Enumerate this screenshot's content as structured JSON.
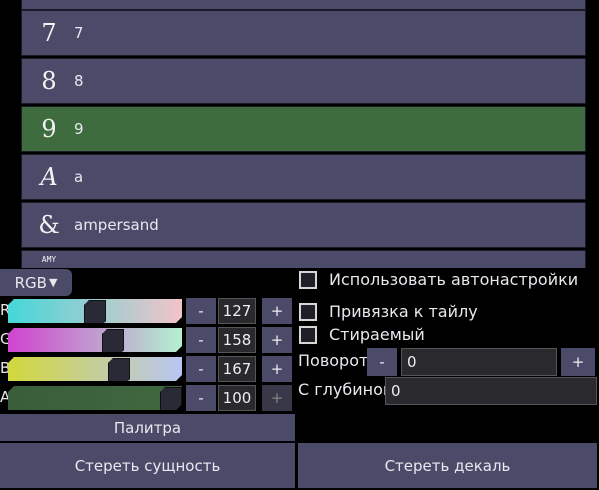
{
  "list": {
    "items": [
      {
        "glyph": "",
        "label": "",
        "selected": false
      },
      {
        "glyph": "7",
        "label": "7",
        "selected": false
      },
      {
        "glyph": "8",
        "label": "8",
        "selected": false
      },
      {
        "glyph": "9",
        "label": "9",
        "selected": true
      },
      {
        "glyph": "A",
        "label": "a",
        "selected": false
      },
      {
        "glyph": "&",
        "label": "ampersand",
        "selected": false
      },
      {
        "glyph": "AMY",
        "label": "",
        "selected": false
      }
    ]
  },
  "color_mode": {
    "label": "RGB",
    "arrow": "▼"
  },
  "channels": [
    {
      "label": "R",
      "value": "127",
      "fraction": 0.498,
      "gradient": [
        "#45d7d8",
        "#f2c4c8"
      ]
    },
    {
      "label": "G",
      "value": "158",
      "fraction": 0.62,
      "gradient": [
        "#d044d0",
        "#b3f0cf"
      ]
    },
    {
      "label": "B",
      "value": "167",
      "fraction": 0.655,
      "gradient": [
        "#d2d83c",
        "#b8c5f3"
      ]
    },
    {
      "label": "A",
      "value": "100",
      "fraction": 1.0,
      "gradient": [
        "#3a5d3a",
        "#3f6840"
      ]
    }
  ],
  "minus_label": "-",
  "plus_label": "+",
  "palette_label": "Палитра",
  "erase_entity_label": "Стереть сущность",
  "erase_decal_label": "Стереть декаль",
  "options": {
    "auto_settings": "Использовать автонастройки",
    "snap_to_tile": "Привязка к тайлу",
    "erasable": "Стираемый"
  },
  "rotation": {
    "label": "Поворот",
    "value": "0"
  },
  "depth": {
    "label": "С глубиной",
    "value": "0"
  },
  "colors": {
    "row": "#4b4b69",
    "selected_row": "#3e6c3e"
  }
}
